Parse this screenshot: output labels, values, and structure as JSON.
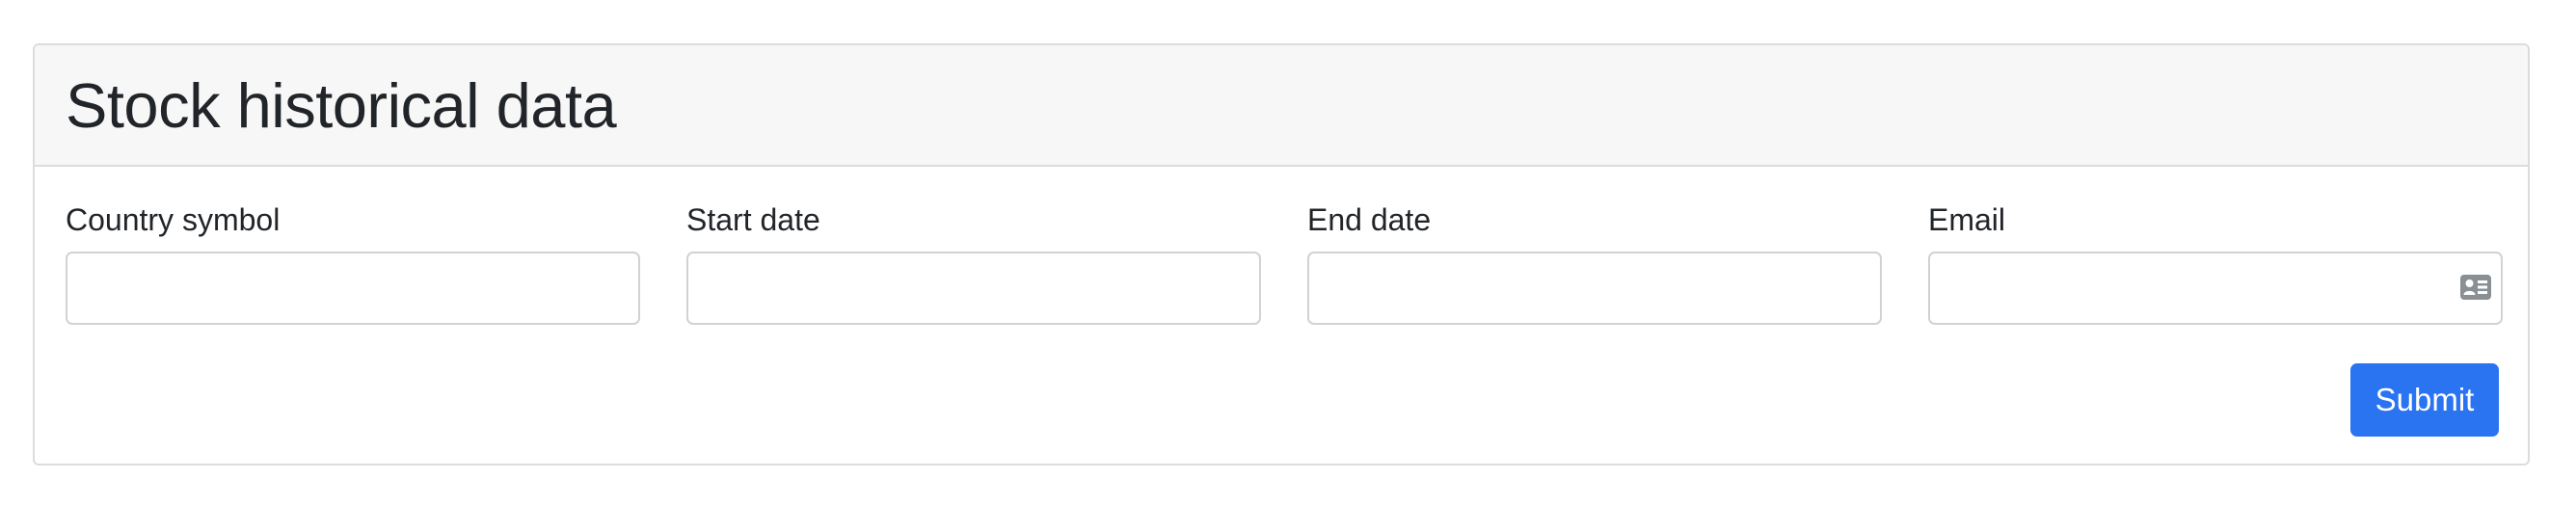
{
  "card": {
    "title": "Stock historical data"
  },
  "form": {
    "fields": [
      {
        "label": "Country symbol",
        "value": "",
        "placeholder": ""
      },
      {
        "label": "Start date",
        "value": "",
        "placeholder": ""
      },
      {
        "label": "End date",
        "value": "",
        "placeholder": ""
      },
      {
        "label": "Email",
        "value": "",
        "placeholder": "",
        "icon": "contact-card-icon"
      }
    ],
    "submit_label": "Submit"
  },
  "colors": {
    "primary": "#2a74f1",
    "header_bg": "#f7f7f7",
    "border": "#dcdcdc",
    "text": "#212529"
  }
}
